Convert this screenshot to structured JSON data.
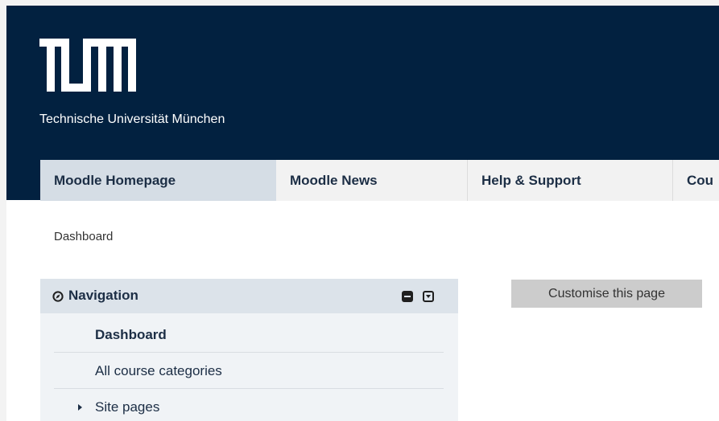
{
  "header": {
    "university_name": "Technische Universität München",
    "logo_name": "TUM",
    "background_color": "#022140"
  },
  "nav": {
    "items": [
      {
        "label": "Moodle Homepage",
        "active": true
      },
      {
        "label": "Moodle News"
      },
      {
        "label": "Help & Support"
      },
      {
        "label": "Cou"
      }
    ]
  },
  "breadcrumb": {
    "label": "Dashboard"
  },
  "navigation_block": {
    "title": "Navigation",
    "items": [
      {
        "label": "Dashboard",
        "bold": true
      },
      {
        "label": "All course categories"
      },
      {
        "label": "Site pages",
        "expandable": true
      }
    ]
  },
  "actions": {
    "customise_label": "Customise this page"
  }
}
